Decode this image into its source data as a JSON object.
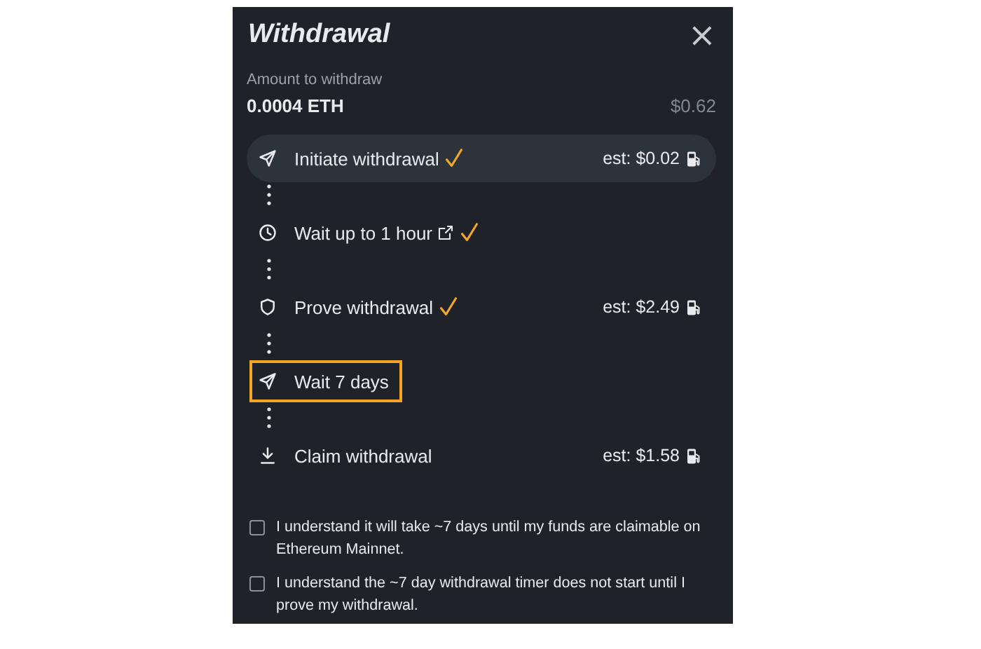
{
  "dialog": {
    "title": "Withdrawal",
    "close": "×"
  },
  "amount": {
    "label": "Amount to withdraw",
    "value": "0.0004 ETH",
    "fiat": "$0.62"
  },
  "steps": [
    {
      "kind": "send",
      "label": "Initiate withdrawal",
      "done": true,
      "current": true,
      "outlined": false,
      "link": false,
      "estimate": "est: $0.02"
    },
    {
      "kind": "clock",
      "label": "Wait up to 1 hour",
      "done": true,
      "current": false,
      "outlined": false,
      "link": true
    },
    {
      "kind": "shield",
      "label": "Prove withdrawal",
      "done": true,
      "current": false,
      "outlined": false,
      "link": false,
      "estimate": "est: $2.49"
    },
    {
      "kind": "send",
      "label": "Wait 7 days",
      "done": false,
      "current": false,
      "outlined": true,
      "link": false
    },
    {
      "kind": "download",
      "label": "Claim withdrawal",
      "done": false,
      "current": false,
      "outlined": false,
      "link": false,
      "estimate": "est: $1.58"
    }
  ],
  "acknowledgements": [
    {
      "text": "I understand it will take ~7 days until my funds are claimable on Ethereum Mainnet.",
      "checked": false
    },
    {
      "text": "I understand the ~7 day withdrawal timer does not start until I prove my withdrawal.",
      "checked": false
    }
  ]
}
